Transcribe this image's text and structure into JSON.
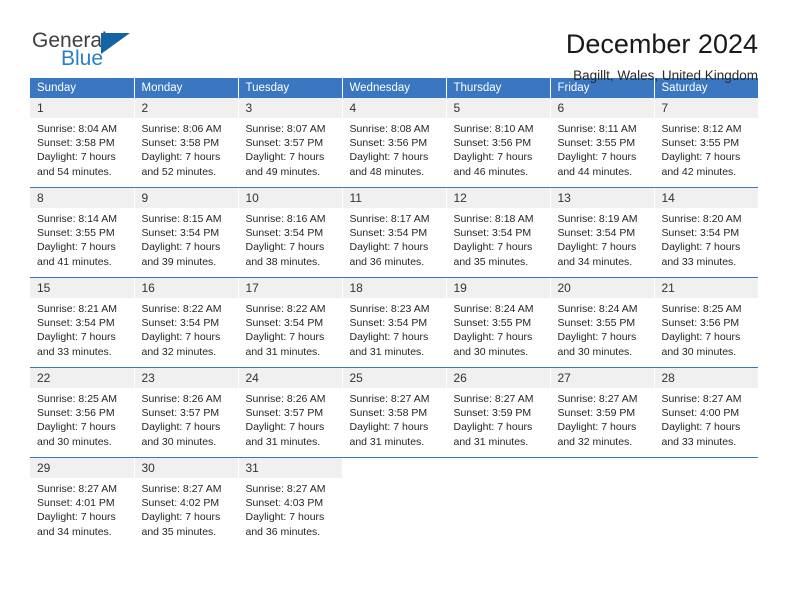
{
  "brand": {
    "word1": "General",
    "word2": "Blue",
    "triangle_icon": "brand-triangle-icon",
    "accent": "#1464a5",
    "blue_text": "#2a7fc4"
  },
  "header": {
    "title": "December 2024",
    "subtitle": "Bagillt, Wales, United Kingdom",
    "header_bar_color": "#3b77c0",
    "daynum_band_color": "#f0f0f0"
  },
  "weekday_headers": [
    "Sunday",
    "Monday",
    "Tuesday",
    "Wednesday",
    "Thursday",
    "Friday",
    "Saturday"
  ],
  "weeks": [
    [
      {
        "day": "1",
        "sunrise": "Sunrise: 8:04 AM",
        "sunset": "Sunset: 3:58 PM",
        "daylight1": "Daylight: 7 hours",
        "daylight2": "and 54 minutes."
      },
      {
        "day": "2",
        "sunrise": "Sunrise: 8:06 AM",
        "sunset": "Sunset: 3:58 PM",
        "daylight1": "Daylight: 7 hours",
        "daylight2": "and 52 minutes."
      },
      {
        "day": "3",
        "sunrise": "Sunrise: 8:07 AM",
        "sunset": "Sunset: 3:57 PM",
        "daylight1": "Daylight: 7 hours",
        "daylight2": "and 49 minutes."
      },
      {
        "day": "4",
        "sunrise": "Sunrise: 8:08 AM",
        "sunset": "Sunset: 3:56 PM",
        "daylight1": "Daylight: 7 hours",
        "daylight2": "and 48 minutes."
      },
      {
        "day": "5",
        "sunrise": "Sunrise: 8:10 AM",
        "sunset": "Sunset: 3:56 PM",
        "daylight1": "Daylight: 7 hours",
        "daylight2": "and 46 minutes."
      },
      {
        "day": "6",
        "sunrise": "Sunrise: 8:11 AM",
        "sunset": "Sunset: 3:55 PM",
        "daylight1": "Daylight: 7 hours",
        "daylight2": "and 44 minutes."
      },
      {
        "day": "7",
        "sunrise": "Sunrise: 8:12 AM",
        "sunset": "Sunset: 3:55 PM",
        "daylight1": "Daylight: 7 hours",
        "daylight2": "and 42 minutes."
      }
    ],
    [
      {
        "day": "8",
        "sunrise": "Sunrise: 8:14 AM",
        "sunset": "Sunset: 3:55 PM",
        "daylight1": "Daylight: 7 hours",
        "daylight2": "and 41 minutes."
      },
      {
        "day": "9",
        "sunrise": "Sunrise: 8:15 AM",
        "sunset": "Sunset: 3:54 PM",
        "daylight1": "Daylight: 7 hours",
        "daylight2": "and 39 minutes."
      },
      {
        "day": "10",
        "sunrise": "Sunrise: 8:16 AM",
        "sunset": "Sunset: 3:54 PM",
        "daylight1": "Daylight: 7 hours",
        "daylight2": "and 38 minutes."
      },
      {
        "day": "11",
        "sunrise": "Sunrise: 8:17 AM",
        "sunset": "Sunset: 3:54 PM",
        "daylight1": "Daylight: 7 hours",
        "daylight2": "and 36 minutes."
      },
      {
        "day": "12",
        "sunrise": "Sunrise: 8:18 AM",
        "sunset": "Sunset: 3:54 PM",
        "daylight1": "Daylight: 7 hours",
        "daylight2": "and 35 minutes."
      },
      {
        "day": "13",
        "sunrise": "Sunrise: 8:19 AM",
        "sunset": "Sunset: 3:54 PM",
        "daylight1": "Daylight: 7 hours",
        "daylight2": "and 34 minutes."
      },
      {
        "day": "14",
        "sunrise": "Sunrise: 8:20 AM",
        "sunset": "Sunset: 3:54 PM",
        "daylight1": "Daylight: 7 hours",
        "daylight2": "and 33 minutes."
      }
    ],
    [
      {
        "day": "15",
        "sunrise": "Sunrise: 8:21 AM",
        "sunset": "Sunset: 3:54 PM",
        "daylight1": "Daylight: 7 hours",
        "daylight2": "and 33 minutes."
      },
      {
        "day": "16",
        "sunrise": "Sunrise: 8:22 AM",
        "sunset": "Sunset: 3:54 PM",
        "daylight1": "Daylight: 7 hours",
        "daylight2": "and 32 minutes."
      },
      {
        "day": "17",
        "sunrise": "Sunrise: 8:22 AM",
        "sunset": "Sunset: 3:54 PM",
        "daylight1": "Daylight: 7 hours",
        "daylight2": "and 31 minutes."
      },
      {
        "day": "18",
        "sunrise": "Sunrise: 8:23 AM",
        "sunset": "Sunset: 3:54 PM",
        "daylight1": "Daylight: 7 hours",
        "daylight2": "and 31 minutes."
      },
      {
        "day": "19",
        "sunrise": "Sunrise: 8:24 AM",
        "sunset": "Sunset: 3:55 PM",
        "daylight1": "Daylight: 7 hours",
        "daylight2": "and 30 minutes."
      },
      {
        "day": "20",
        "sunrise": "Sunrise: 8:24 AM",
        "sunset": "Sunset: 3:55 PM",
        "daylight1": "Daylight: 7 hours",
        "daylight2": "and 30 minutes."
      },
      {
        "day": "21",
        "sunrise": "Sunrise: 8:25 AM",
        "sunset": "Sunset: 3:56 PM",
        "daylight1": "Daylight: 7 hours",
        "daylight2": "and 30 minutes."
      }
    ],
    [
      {
        "day": "22",
        "sunrise": "Sunrise: 8:25 AM",
        "sunset": "Sunset: 3:56 PM",
        "daylight1": "Daylight: 7 hours",
        "daylight2": "and 30 minutes."
      },
      {
        "day": "23",
        "sunrise": "Sunrise: 8:26 AM",
        "sunset": "Sunset: 3:57 PM",
        "daylight1": "Daylight: 7 hours",
        "daylight2": "and 30 minutes."
      },
      {
        "day": "24",
        "sunrise": "Sunrise: 8:26 AM",
        "sunset": "Sunset: 3:57 PM",
        "daylight1": "Daylight: 7 hours",
        "daylight2": "and 31 minutes."
      },
      {
        "day": "25",
        "sunrise": "Sunrise: 8:27 AM",
        "sunset": "Sunset: 3:58 PM",
        "daylight1": "Daylight: 7 hours",
        "daylight2": "and 31 minutes."
      },
      {
        "day": "26",
        "sunrise": "Sunrise: 8:27 AM",
        "sunset": "Sunset: 3:59 PM",
        "daylight1": "Daylight: 7 hours",
        "daylight2": "and 31 minutes."
      },
      {
        "day": "27",
        "sunrise": "Sunrise: 8:27 AM",
        "sunset": "Sunset: 3:59 PM",
        "daylight1": "Daylight: 7 hours",
        "daylight2": "and 32 minutes."
      },
      {
        "day": "28",
        "sunrise": "Sunrise: 8:27 AM",
        "sunset": "Sunset: 4:00 PM",
        "daylight1": "Daylight: 7 hours",
        "daylight2": "and 33 minutes."
      }
    ],
    [
      {
        "day": "29",
        "sunrise": "Sunrise: 8:27 AM",
        "sunset": "Sunset: 4:01 PM",
        "daylight1": "Daylight: 7 hours",
        "daylight2": "and 34 minutes."
      },
      {
        "day": "30",
        "sunrise": "Sunrise: 8:27 AM",
        "sunset": "Sunset: 4:02 PM",
        "daylight1": "Daylight: 7 hours",
        "daylight2": "and 35 minutes."
      },
      {
        "day": "31",
        "sunrise": "Sunrise: 8:27 AM",
        "sunset": "Sunset: 4:03 PM",
        "daylight1": "Daylight: 7 hours",
        "daylight2": "and 36 minutes."
      },
      {
        "day": "",
        "sunrise": "",
        "sunset": "",
        "daylight1": "",
        "daylight2": ""
      },
      {
        "day": "",
        "sunrise": "",
        "sunset": "",
        "daylight1": "",
        "daylight2": ""
      },
      {
        "day": "",
        "sunrise": "",
        "sunset": "",
        "daylight1": "",
        "daylight2": ""
      },
      {
        "day": "",
        "sunrise": "",
        "sunset": "",
        "daylight1": "",
        "daylight2": ""
      }
    ]
  ]
}
